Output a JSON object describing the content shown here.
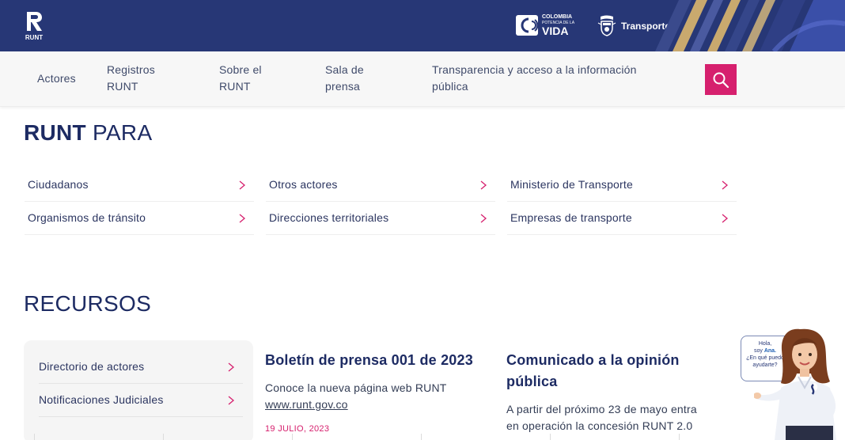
{
  "header": {
    "logo_text": "RUNT",
    "brand_colombia": "COLOMBIA",
    "brand_potencia": "POTENCIA DE LA",
    "brand_vida": "VIDA",
    "transporte": "Transporte"
  },
  "nav": {
    "items": [
      {
        "line1": "Actores",
        "line2": ""
      },
      {
        "line1": "Registros",
        "line2": "RUNT"
      },
      {
        "line1": "Sobre el",
        "line2": "RUNT"
      },
      {
        "line1": "Sala de",
        "line2": "prensa"
      },
      {
        "line1": "Transparencia y acceso a la información",
        "line2": "pública"
      }
    ],
    "search_icon": "search-icon"
  },
  "runt_para": {
    "title_bold": "RUNT",
    "title_rest": " PARA",
    "links": [
      "Ciudadanos",
      "Otros actores",
      "Ministerio de Transporte",
      "Organismos de tránsito",
      "Direcciones territoriales",
      "Empresas de transporte"
    ]
  },
  "recursos": {
    "title": "RECURSOS",
    "links": [
      "Directorio de actores",
      "Notificaciones Judiciales"
    ],
    "news": [
      {
        "title": "Boletín de prensa 001 de 2023",
        "text": "Conoce la nueva página web RUNT",
        "link": "www.runt.gov.co",
        "date": "19 JULIO, 2023"
      },
      {
        "title_line1": "Comunicado a la opinión",
        "title_line2": "pública",
        "text_line1": "A partir del próximo 23 de mayo entra",
        "text_line2": "en operación la concesión RUNT 2.0"
      }
    ]
  },
  "assistant": {
    "line1": "Hola,",
    "line2_pre": "soy ",
    "line2_name": "Ana.",
    "line3": "¿En qué puedo",
    "line4": "ayudarte?"
  },
  "colors": {
    "header_bg": "#273776",
    "accent": "#d6206e",
    "nav_bg": "#f7f7f7"
  }
}
